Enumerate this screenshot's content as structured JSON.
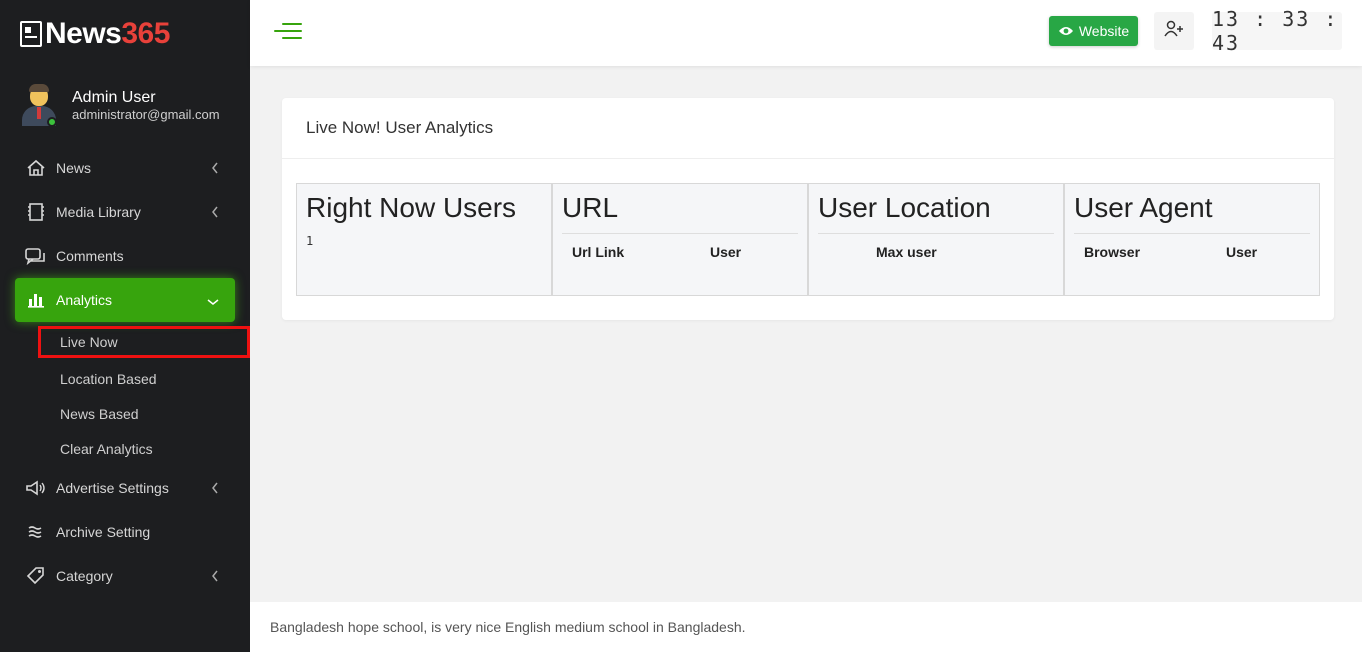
{
  "brand": {
    "news": "News",
    "num": "365"
  },
  "user": {
    "name": "Admin User",
    "email": "administrator@gmail.com"
  },
  "nav": {
    "news": "News",
    "media": "Media Library",
    "comments": "Comments",
    "analytics": "Analytics",
    "sub": [
      "Live Now",
      "Location Based",
      "News Based",
      "Clear Analytics"
    ],
    "advertise": "Advertise Settings",
    "archive": "Archive Setting",
    "category": "Category"
  },
  "topbar": {
    "website_label": "Website",
    "clock": "13 : 33 : 43"
  },
  "card": {
    "title": "Live Now! User Analytics",
    "cols": {
      "now": {
        "title": "Right Now Users",
        "count": "1"
      },
      "url": {
        "title": "URL",
        "h1": "Url Link",
        "h2": "User"
      },
      "loc": {
        "title": "User Location",
        "h1": "Max user"
      },
      "agent": {
        "title": "User Agent",
        "h1": "Browser",
        "h2": "User"
      }
    }
  },
  "footer": {
    "text": "Bangladesh hope school, is very nice English medium school in Bangladesh."
  },
  "colors": {
    "accent": "#37a40d",
    "website_btn": "#28a745",
    "brand_red": "#e8413a",
    "highlight": "#ee1111",
    "sidebar": "#1d1e20"
  }
}
